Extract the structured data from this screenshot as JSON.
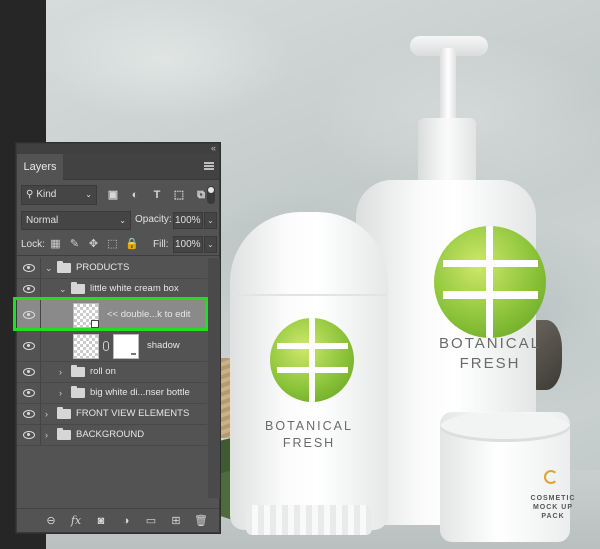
{
  "panel": {
    "tab_label": "Layers",
    "collapse_glyph": "«",
    "filter": {
      "kind_label": "Kind",
      "search_glyph": "⚲",
      "chevron": "⌄",
      "icons": [
        {
          "name": "pixel-filter-icon",
          "glyph": "▣"
        },
        {
          "name": "adjustment-filter-icon",
          "glyph": "◐"
        },
        {
          "name": "type-filter-icon",
          "glyph": "T"
        },
        {
          "name": "shape-filter-icon",
          "glyph": "⬚"
        },
        {
          "name": "smart-object-filter-icon",
          "glyph": "⧉"
        }
      ]
    },
    "blend_mode": "Normal",
    "opacity_label": "Opacity:",
    "opacity_value": "100%",
    "lock_label": "Lock:",
    "lock_icons": [
      {
        "name": "lock-transparent-pixels-icon",
        "glyph": "▦"
      },
      {
        "name": "lock-image-pixels-icon",
        "glyph": "✎"
      },
      {
        "name": "lock-position-icon",
        "glyph": "✥"
      },
      {
        "name": "lock-artboard-icon",
        "glyph": "⬚"
      },
      {
        "name": "lock-all-icon",
        "glyph": "🔒"
      }
    ],
    "fill_label": "Fill:",
    "fill_value": "100%",
    "dropdown_arrow": "⌄",
    "twist_open": "⌄",
    "twist_closed": "›",
    "layers": [
      {
        "label": "PRODUCTS",
        "type": "group",
        "expanded": true,
        "indent": 0
      },
      {
        "label": "little white cream box",
        "type": "group",
        "expanded": true,
        "indent": 1
      },
      {
        "label": "<< double...k to edit",
        "type": "smart",
        "selected": true,
        "indent": 2
      },
      {
        "label": "shadow",
        "type": "masked",
        "indent": 2
      },
      {
        "label": "roll on",
        "type": "group",
        "expanded": false,
        "indent": 1
      },
      {
        "label": "big white di...nser bottle",
        "type": "group",
        "expanded": false,
        "indent": 1
      },
      {
        "label": "FRONT VIEW ELEMENTS",
        "type": "group",
        "expanded": false,
        "indent": 0
      },
      {
        "label": "BACKGROUND",
        "type": "group",
        "expanded": false,
        "indent": 0
      }
    ],
    "bottom_icons": [
      {
        "name": "link-layers-icon",
        "glyph": "⊖"
      },
      {
        "name": "layer-style-icon",
        "glyph": "fx"
      },
      {
        "name": "add-mask-icon",
        "glyph": "◙"
      },
      {
        "name": "adjustment-layer-icon",
        "glyph": "◑"
      },
      {
        "name": "new-group-icon",
        "glyph": "▭"
      },
      {
        "name": "new-layer-icon",
        "glyph": "⊞"
      },
      {
        "name": "delete-layer-icon",
        "glyph": "🗑"
      }
    ]
  },
  "scene": {
    "bottle_brand_line1": "BOTANICAL",
    "bottle_brand_line2": "FRESH",
    "stick_brand_line1": "BOTANICAL",
    "stick_brand_line2": "FRESH",
    "jar_text_line1": "COSMETIC",
    "jar_text_line2": "MOCK UP",
    "jar_text_line3": "PACK",
    "logo_color": "#8cc43a"
  },
  "highlight_color": "#22dd22"
}
